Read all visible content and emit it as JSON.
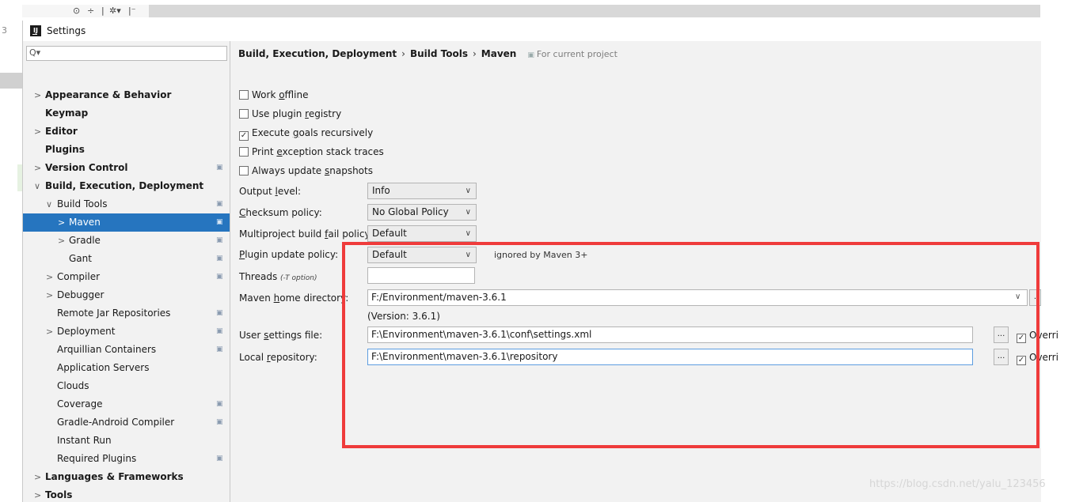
{
  "ide": {
    "gutter_number": "3",
    "toolbar_icons": [
      "⊙",
      "÷",
      "|",
      "✲▾",
      "|⁻"
    ]
  },
  "window": {
    "title": "Settings",
    "app_icon_text": "IJ"
  },
  "search": {
    "value": "",
    "icon": "search-icon"
  },
  "sidebar": {
    "items": [
      {
        "label": "Appearance & Behavior",
        "arrow": ">",
        "bold": true,
        "project": false
      },
      {
        "label": "Keymap",
        "arrow": "",
        "bold": true,
        "project": false
      },
      {
        "label": "Editor",
        "arrow": ">",
        "bold": true,
        "project": false
      },
      {
        "label": "Plugins",
        "arrow": "",
        "bold": true,
        "project": false
      },
      {
        "label": "Version Control",
        "arrow": ">",
        "bold": true,
        "project": true
      },
      {
        "label": "Build, Execution, Deployment",
        "arrow": "∨",
        "bold": true,
        "project": false
      },
      {
        "label": "Build Tools",
        "arrow": "∨",
        "bold": false,
        "project": true
      },
      {
        "label": "Maven",
        "arrow": ">",
        "bold": false,
        "project": true,
        "selected": true
      },
      {
        "label": "Gradle",
        "arrow": ">",
        "bold": false,
        "project": true
      },
      {
        "label": "Gant",
        "arrow": "",
        "bold": false,
        "project": true
      },
      {
        "label": "Compiler",
        "arrow": ">",
        "bold": false,
        "project": true
      },
      {
        "label": "Debugger",
        "arrow": ">",
        "bold": false,
        "project": false
      },
      {
        "label": "Remote Jar Repositories",
        "arrow": "",
        "bold": false,
        "project": true
      },
      {
        "label": "Deployment",
        "arrow": ">",
        "bold": false,
        "project": true
      },
      {
        "label": "Arquillian Containers",
        "arrow": "",
        "bold": false,
        "project": true
      },
      {
        "label": "Application Servers",
        "arrow": "",
        "bold": false,
        "project": false
      },
      {
        "label": "Clouds",
        "arrow": "",
        "bold": false,
        "project": false
      },
      {
        "label": "Coverage",
        "arrow": "",
        "bold": false,
        "project": true
      },
      {
        "label": "Gradle-Android Compiler",
        "arrow": "",
        "bold": false,
        "project": true
      },
      {
        "label": "Instant Run",
        "arrow": "",
        "bold": false,
        "project": false
      },
      {
        "label": "Required Plugins",
        "arrow": "",
        "bold": false,
        "project": true
      },
      {
        "label": "Languages & Frameworks",
        "arrow": ">",
        "bold": true,
        "project": false
      },
      {
        "label": "Tools",
        "arrow": ">",
        "bold": true,
        "project": false
      }
    ],
    "project_icon": "▣"
  },
  "breadcrumb": {
    "parts": [
      "Build, Execution, Deployment",
      "Build Tools",
      "Maven"
    ],
    "separator": "›",
    "scope": "For current project"
  },
  "maven": {
    "checkboxes": [
      {
        "pre": "Work ",
        "u": "o",
        "post": "ffline",
        "checked": false
      },
      {
        "pre": "Use plugin ",
        "u": "r",
        "post": "egistry",
        "checked": false
      },
      {
        "pre": "Execute ",
        "u": "g",
        "post": "oals recursively",
        "checked": true
      },
      {
        "pre": "Print ",
        "u": "e",
        "post": "xception stack traces",
        "checked": false
      },
      {
        "pre": "Always update ",
        "u": "s",
        "post": "napshots",
        "checked": false
      }
    ],
    "output_level": {
      "pre": "Output ",
      "u": "l",
      "post": "evel:",
      "value": "Info"
    },
    "checksum_policy": {
      "pre": "",
      "u": "C",
      "post": "hecksum policy:",
      "value": "No Global Policy"
    },
    "multiproject_policy": {
      "pre": "Multiproject build ",
      "u": "f",
      "post": "ail policy:",
      "value": "Default"
    },
    "plugin_update_policy": {
      "pre": "",
      "u": "P",
      "post": "lugin update policy:",
      "value": "Default",
      "hint": "ignored by Maven 3+"
    },
    "threads": {
      "label": "Threads ",
      "hint": "(-T option)",
      "value": ""
    },
    "home_directory": {
      "pre": "Maven ",
      "u": "h",
      "post": "ome directory:",
      "value": "F:/Environment/maven-3.6.1"
    },
    "version": "(Version: 3.6.1)",
    "user_settings": {
      "pre": "User ",
      "u": "s",
      "post": "ettings file:",
      "value": "F:\\Environment\\maven-3.6.1\\conf\\settings.xml",
      "override": "Overri"
    },
    "local_repository": {
      "pre": "Local ",
      "u": "r",
      "post": "epository:",
      "value": "F:\\Environment\\maven-3.6.1\\repository",
      "override": "Overri"
    },
    "browse_label": "...",
    "check_mark": "✓"
  },
  "watermark": "https://blog.csdn.net/yalu_123456",
  "colors": {
    "selection": "#2675bf",
    "annotation_box": "#ef3b3b"
  }
}
